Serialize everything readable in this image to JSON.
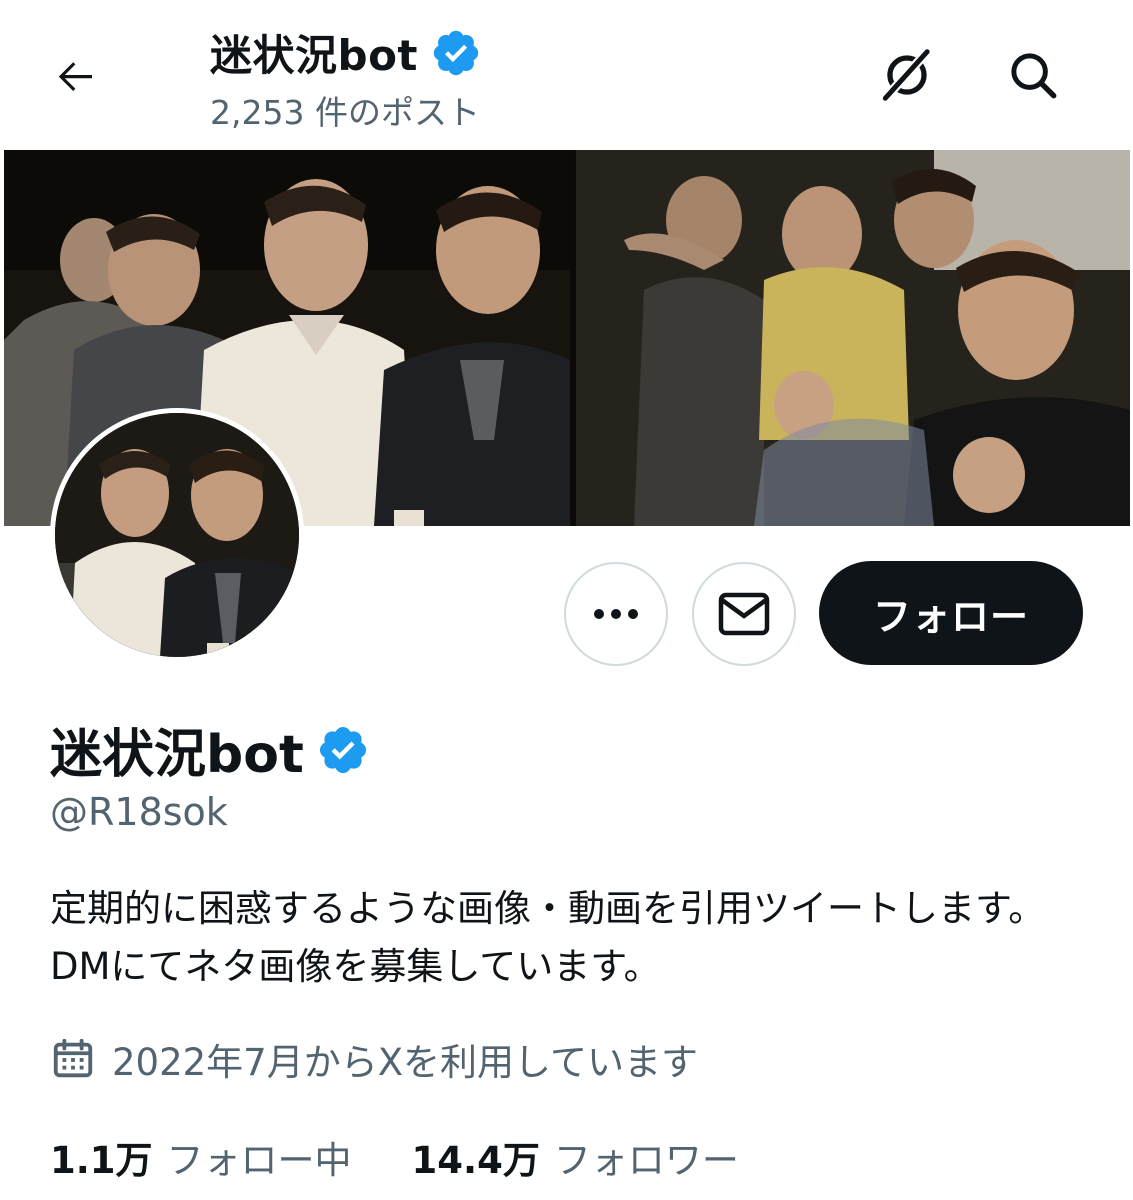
{
  "header": {
    "title": "迷状況bot",
    "post_count": "2,253 件のポスト",
    "back_icon": "arrow-left-icon",
    "grok_icon": "grok-icon",
    "search_icon": "search-icon"
  },
  "profile": {
    "display_name": "迷状況bot",
    "verified": true,
    "handle": "@R18sok",
    "bio": "定期的に困惑するような画像・動画を引用ツイートします。DMにてネタ画像を募集しています。",
    "joined": "2022年7月からXを利用しています",
    "following_count": "1.1万",
    "following_label": "フォロー中",
    "followers_count": "14.4万",
    "followers_label": "フォロワー"
  },
  "actions": {
    "more_icon": "more-icon",
    "dm_icon": "envelope-icon",
    "follow_label": "フォロー"
  },
  "colors": {
    "verified_blue": "#1d9bf0",
    "text_primary": "#0f1419",
    "text_secondary": "#536471",
    "border": "#cfd9de"
  }
}
